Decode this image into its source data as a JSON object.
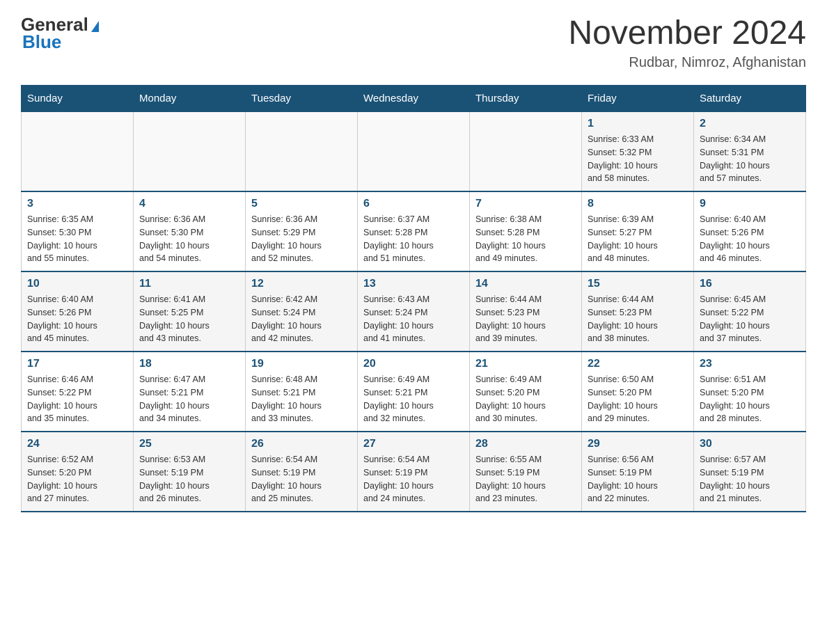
{
  "header": {
    "logo_general": "General",
    "logo_blue": "Blue",
    "month_title": "November 2024",
    "location": "Rudbar, Nimroz, Afghanistan"
  },
  "days_of_week": [
    "Sunday",
    "Monday",
    "Tuesday",
    "Wednesday",
    "Thursday",
    "Friday",
    "Saturday"
  ],
  "weeks": [
    [
      {
        "day": "",
        "info": ""
      },
      {
        "day": "",
        "info": ""
      },
      {
        "day": "",
        "info": ""
      },
      {
        "day": "",
        "info": ""
      },
      {
        "day": "",
        "info": ""
      },
      {
        "day": "1",
        "info": "Sunrise: 6:33 AM\nSunset: 5:32 PM\nDaylight: 10 hours\nand 58 minutes."
      },
      {
        "day": "2",
        "info": "Sunrise: 6:34 AM\nSunset: 5:31 PM\nDaylight: 10 hours\nand 57 minutes."
      }
    ],
    [
      {
        "day": "3",
        "info": "Sunrise: 6:35 AM\nSunset: 5:30 PM\nDaylight: 10 hours\nand 55 minutes."
      },
      {
        "day": "4",
        "info": "Sunrise: 6:36 AM\nSunset: 5:30 PM\nDaylight: 10 hours\nand 54 minutes."
      },
      {
        "day": "5",
        "info": "Sunrise: 6:36 AM\nSunset: 5:29 PM\nDaylight: 10 hours\nand 52 minutes."
      },
      {
        "day": "6",
        "info": "Sunrise: 6:37 AM\nSunset: 5:28 PM\nDaylight: 10 hours\nand 51 minutes."
      },
      {
        "day": "7",
        "info": "Sunrise: 6:38 AM\nSunset: 5:28 PM\nDaylight: 10 hours\nand 49 minutes."
      },
      {
        "day": "8",
        "info": "Sunrise: 6:39 AM\nSunset: 5:27 PM\nDaylight: 10 hours\nand 48 minutes."
      },
      {
        "day": "9",
        "info": "Sunrise: 6:40 AM\nSunset: 5:26 PM\nDaylight: 10 hours\nand 46 minutes."
      }
    ],
    [
      {
        "day": "10",
        "info": "Sunrise: 6:40 AM\nSunset: 5:26 PM\nDaylight: 10 hours\nand 45 minutes."
      },
      {
        "day": "11",
        "info": "Sunrise: 6:41 AM\nSunset: 5:25 PM\nDaylight: 10 hours\nand 43 minutes."
      },
      {
        "day": "12",
        "info": "Sunrise: 6:42 AM\nSunset: 5:24 PM\nDaylight: 10 hours\nand 42 minutes."
      },
      {
        "day": "13",
        "info": "Sunrise: 6:43 AM\nSunset: 5:24 PM\nDaylight: 10 hours\nand 41 minutes."
      },
      {
        "day": "14",
        "info": "Sunrise: 6:44 AM\nSunset: 5:23 PM\nDaylight: 10 hours\nand 39 minutes."
      },
      {
        "day": "15",
        "info": "Sunrise: 6:44 AM\nSunset: 5:23 PM\nDaylight: 10 hours\nand 38 minutes."
      },
      {
        "day": "16",
        "info": "Sunrise: 6:45 AM\nSunset: 5:22 PM\nDaylight: 10 hours\nand 37 minutes."
      }
    ],
    [
      {
        "day": "17",
        "info": "Sunrise: 6:46 AM\nSunset: 5:22 PM\nDaylight: 10 hours\nand 35 minutes."
      },
      {
        "day": "18",
        "info": "Sunrise: 6:47 AM\nSunset: 5:21 PM\nDaylight: 10 hours\nand 34 minutes."
      },
      {
        "day": "19",
        "info": "Sunrise: 6:48 AM\nSunset: 5:21 PM\nDaylight: 10 hours\nand 33 minutes."
      },
      {
        "day": "20",
        "info": "Sunrise: 6:49 AM\nSunset: 5:21 PM\nDaylight: 10 hours\nand 32 minutes."
      },
      {
        "day": "21",
        "info": "Sunrise: 6:49 AM\nSunset: 5:20 PM\nDaylight: 10 hours\nand 30 minutes."
      },
      {
        "day": "22",
        "info": "Sunrise: 6:50 AM\nSunset: 5:20 PM\nDaylight: 10 hours\nand 29 minutes."
      },
      {
        "day": "23",
        "info": "Sunrise: 6:51 AM\nSunset: 5:20 PM\nDaylight: 10 hours\nand 28 minutes."
      }
    ],
    [
      {
        "day": "24",
        "info": "Sunrise: 6:52 AM\nSunset: 5:20 PM\nDaylight: 10 hours\nand 27 minutes."
      },
      {
        "day": "25",
        "info": "Sunrise: 6:53 AM\nSunset: 5:19 PM\nDaylight: 10 hours\nand 26 minutes."
      },
      {
        "day": "26",
        "info": "Sunrise: 6:54 AM\nSunset: 5:19 PM\nDaylight: 10 hours\nand 25 minutes."
      },
      {
        "day": "27",
        "info": "Sunrise: 6:54 AM\nSunset: 5:19 PM\nDaylight: 10 hours\nand 24 minutes."
      },
      {
        "day": "28",
        "info": "Sunrise: 6:55 AM\nSunset: 5:19 PM\nDaylight: 10 hours\nand 23 minutes."
      },
      {
        "day": "29",
        "info": "Sunrise: 6:56 AM\nSunset: 5:19 PM\nDaylight: 10 hours\nand 22 minutes."
      },
      {
        "day": "30",
        "info": "Sunrise: 6:57 AM\nSunset: 5:19 PM\nDaylight: 10 hours\nand 21 minutes."
      }
    ]
  ]
}
